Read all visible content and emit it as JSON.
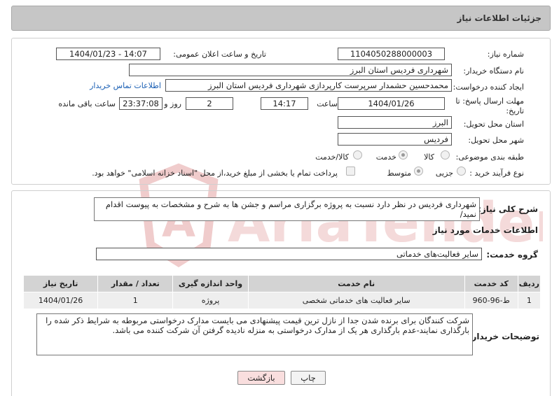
{
  "header": {
    "title": "جزئیات اطلاعات نیاز"
  },
  "watermark": {
    "text": "AriaTender.neT"
  },
  "form": {
    "need_number_label": "شماره نیاز:",
    "need_number": "1104050288000003",
    "announce_label": "تاریخ و ساعت اعلان عمومی:",
    "announce_value": "1404/01/23 - 14:07",
    "buyer_label": "نام دستگاه خریدار:",
    "buyer_value": "شهرداری فردیس استان البرز",
    "creator_label": "ایجاد کننده درخواست:",
    "creator_value": "محمدحسین حشمدار سرپرست کارپردازی شهرداری فردیس استان البرز",
    "contact_link": "اطلاعات تماس خریدار",
    "deadline_label_line1": "مهلت ارسال پاسخ: تا",
    "deadline_label_line2": "تاریخ:",
    "deadline_date": "1404/01/26",
    "time_label": "ساعت",
    "deadline_time": "14:17",
    "days_value": "2",
    "days_label": "روز و",
    "remaining_time": "23:37:08",
    "remaining_label": "ساعت باقی مانده",
    "province_label": "استان محل تحویل:",
    "province_value": "البرز",
    "city_label": "شهر محل تحویل:",
    "city_value": "فردیس",
    "category_label": "طبقه بندی موضوعی:",
    "category_options": [
      "کالا",
      "خدمت",
      "کالا/خدمت"
    ],
    "category_selected": "خدمت",
    "purchase_type_label": "نوع فرآیند خرید :",
    "purchase_options": [
      "جزیی",
      "متوسط"
    ],
    "purchase_selected": "متوسط",
    "treasury_note": "پرداخت تمام یا بخشی از مبلغ خرید،از محل \"اسناد خزانه اسلامی\" خواهد بود."
  },
  "description": {
    "label": "شرح کلی نیاز:",
    "text": "شهرداری فردیس در نظر دارد نسبت به پروژه برگزاری مراسم و جشن ها به شرح و مشخصات به پیوست اقدام نمید/"
  },
  "services": {
    "section_title": "اطلاعات خدمات مورد نیاز",
    "group_label": "گروه خدمت:",
    "group_value": "سایر فعالیت‌های خدماتی",
    "columns": [
      "ردیف",
      "کد خدمت",
      "نام خدمت",
      "واحد اندازه گیری",
      "تعداد / مقدار",
      "تاریخ نیاز"
    ],
    "rows": [
      {
        "row": "1",
        "code": "ط-96-960",
        "name": "سایر فعالیت های خدماتی شخصی",
        "unit": "پروژه",
        "qty": "1",
        "date": "1404/01/26"
      }
    ]
  },
  "buyer_notes": {
    "label": "توضیحات خریدار:",
    "text": "شرکت کنندگان برای برنده شدن جدا از نازل ترین قیمت پیشنهادی می بایست مدارک درخواستی مربوطه به شرایط ذکر شده را بارگذاری نمایند-عدم بارگذاری هر یک از مدارک درخواستی به منزله نادیده گرفتن آن شرکت کننده می باشد."
  },
  "buttons": {
    "print": "چاپ",
    "back": "بازگشت"
  },
  "colors": {
    "header_bg": "#c6c6c6",
    "table_header": "#d3d3d3",
    "table_row": "#eeeeee",
    "link": "#1a5fb4",
    "back_button": "#f9dede",
    "watermark": "#f2d3d3"
  }
}
